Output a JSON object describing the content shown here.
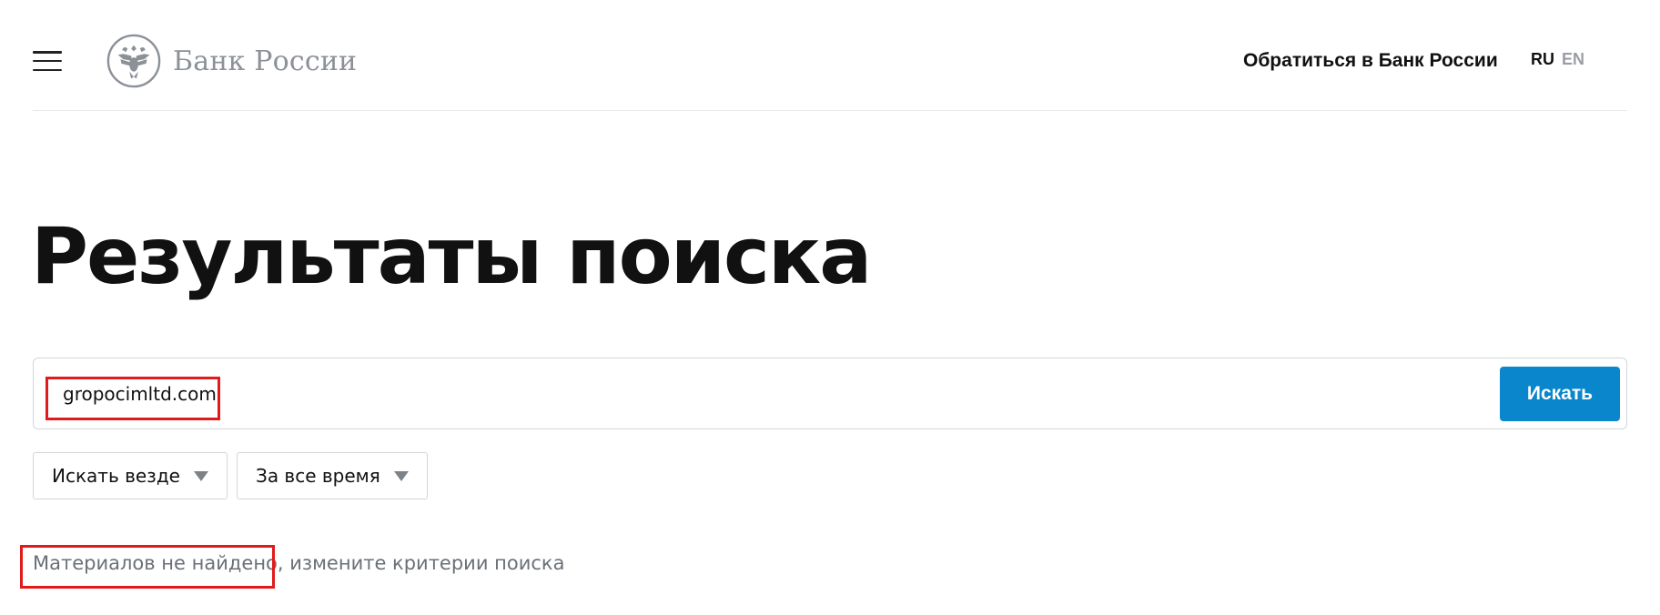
{
  "header": {
    "logo_text": "Банк России",
    "contact_link": "Обратиться в Банк России",
    "languages": [
      {
        "code": "RU",
        "active": true
      },
      {
        "code": "EN",
        "active": false
      }
    ]
  },
  "main": {
    "title": "Результаты поиска",
    "search": {
      "value": "gropocimltd.com",
      "button_label": "Искать"
    },
    "filters": {
      "scope": "Искать везде",
      "period": "За все время"
    },
    "message": {
      "part1": "Материалов не найдено",
      "part2": ", измените критерии поиска"
    }
  },
  "colors": {
    "accent_blue": "#0a86cc",
    "highlight_red": "#e11b1b",
    "logo_gray": "#8c9198",
    "muted_text": "#6b7077"
  },
  "icons": [
    "menu-icon",
    "bank-emblem-icon",
    "triangle-down-icon"
  ]
}
